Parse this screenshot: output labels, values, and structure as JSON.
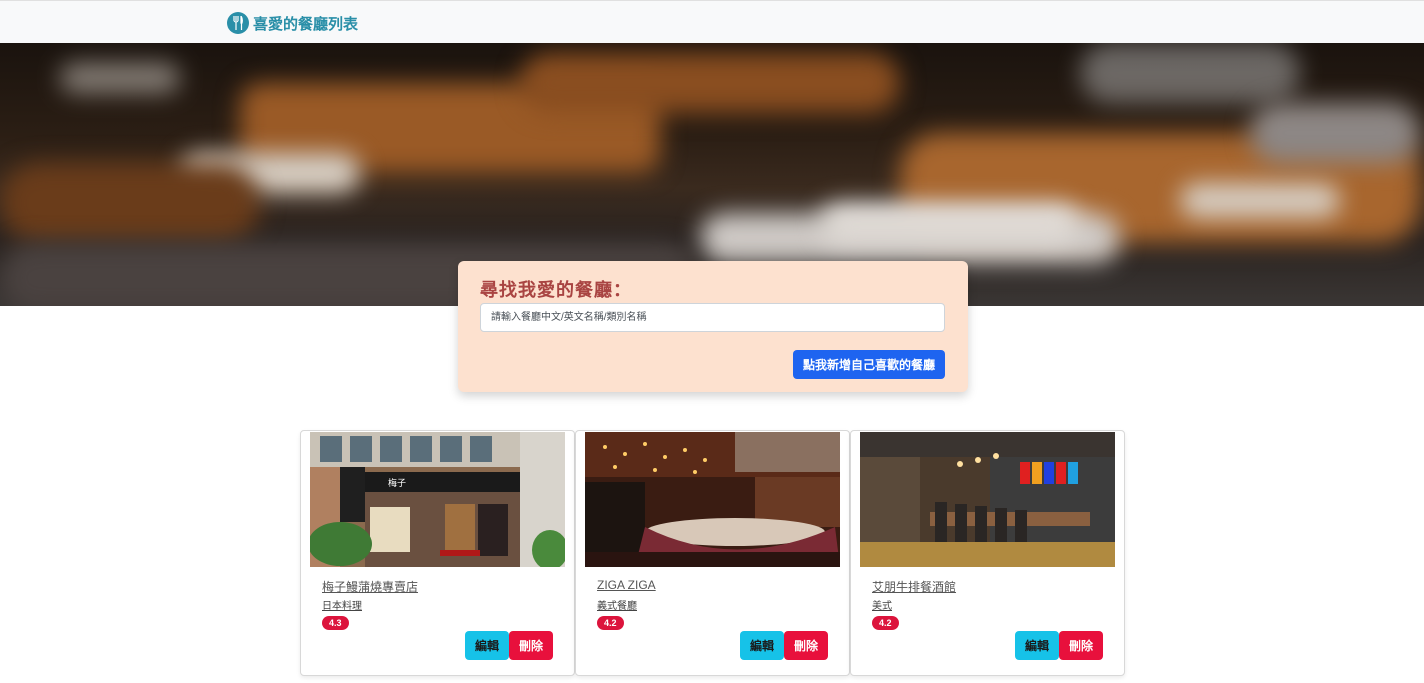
{
  "navbar": {
    "brand_icon": "utensils-icon",
    "brand_title": "喜愛的餐廳列表"
  },
  "search": {
    "title": "尋找我愛的餐廳：",
    "placeholder": "請輸入餐廳中文/英文名稱/類別名稱",
    "add_button_label": "點我新增自己喜歡的餐廳"
  },
  "restaurants": [
    {
      "name": "梅子鰻蒲燒專賣店",
      "category": "日本料理",
      "rating": "4.3",
      "edit_label": "編輯",
      "delete_label": "刪除"
    },
    {
      "name": "ZIGA ZIGA",
      "category": "義式餐廳",
      "rating": "4.2",
      "edit_label": "編輯",
      "delete_label": "刪除"
    },
    {
      "name": "艾朋牛排餐酒館",
      "category": "美式",
      "rating": "4.2",
      "edit_label": "編輯",
      "delete_label": "刪除"
    }
  ],
  "colors": {
    "brand": "#2a8fa8",
    "search_card_bg": "#fde1cf",
    "search_title": "#a94442",
    "primary_button": "#1e64f0",
    "edit_button": "#16c2e8",
    "delete_button": "#e8103c",
    "rating_badge": "#dc143c"
  }
}
